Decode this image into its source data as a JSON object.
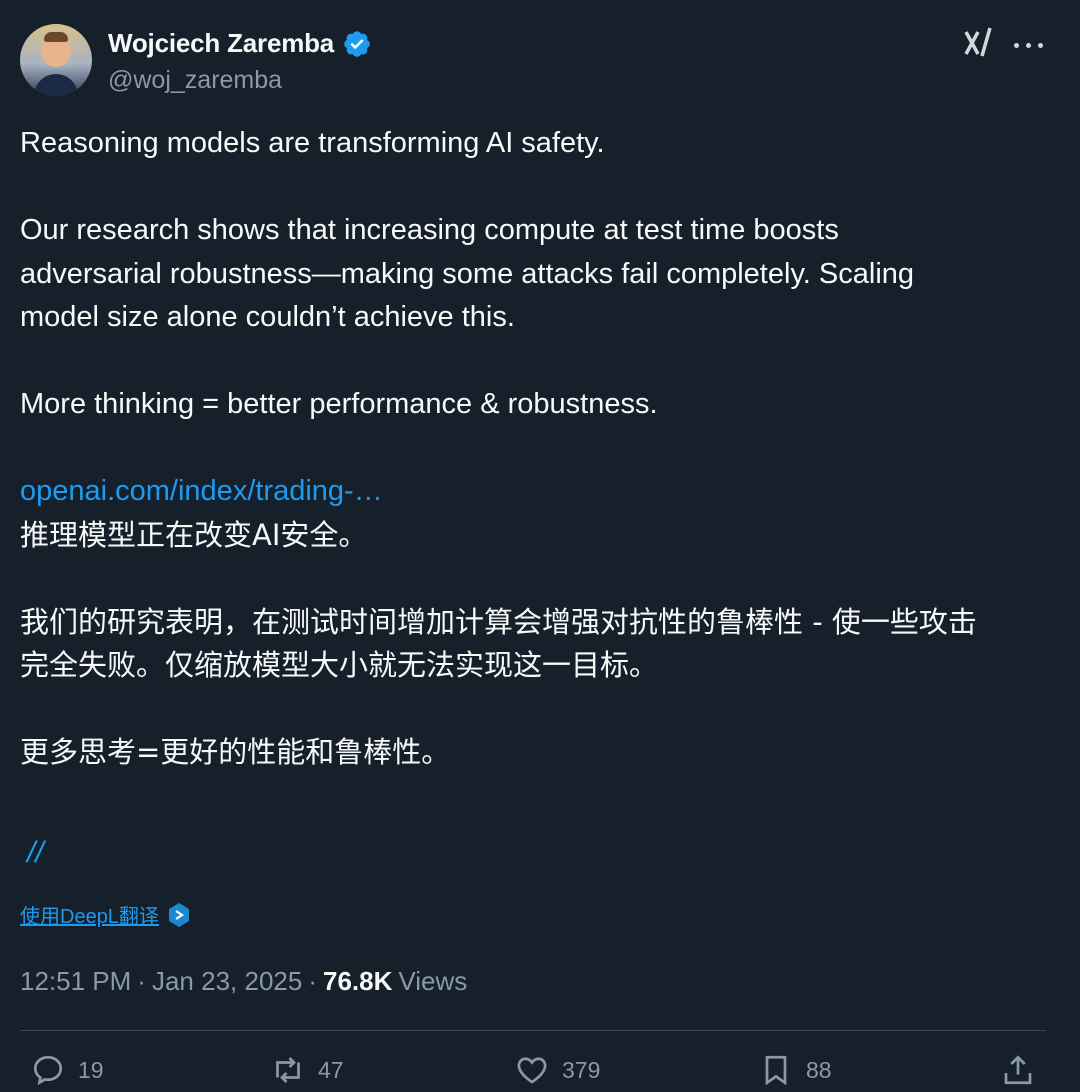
{
  "author": {
    "name": "Wojciech Zaremba",
    "handle": "@woj_zaremba",
    "verified_icon": "verified-badge-icon",
    "accent": "#1d9bf0"
  },
  "post": {
    "line1": "Reasoning models are transforming AI safety.",
    "line2": "Our research shows that increasing compute at test time boosts",
    "line3": "adversarial robustness—making some attacks fail completely. Scaling",
    "line4": "model size alone couldn’t achieve this.",
    "line5": "More thinking = better performance & robustness.",
    "link": "openai.com/index/trading-…",
    "cn1": "推理模型正在改变AI安全。",
    "cn2": "我们的研究表明，在测试时间增加计算会增强对抗性的鲁棒性 - 使一些攻击",
    "cn3": "完全失败。仅缩放模型大小就无法实现这一目标。",
    "cn4": "更多思考=更好的性能和鲁棒性。",
    "slashes": "//"
  },
  "translate": {
    "label": "使用DeepL翻译",
    "icon": "deepl-icon"
  },
  "meta": {
    "time": "12:51 PM",
    "sep1": "·",
    "date": "Jan 23, 2025",
    "sep2": "·",
    "views_count": "76.8K",
    "views_label": "Views"
  },
  "actions": {
    "replies": "19",
    "reposts": "47",
    "likes": "379",
    "bookmarks": "88"
  },
  "colors": {
    "background": "#15202b",
    "text": "#f7f9f9",
    "muted": "#8b98a5",
    "divider": "#38444d"
  }
}
